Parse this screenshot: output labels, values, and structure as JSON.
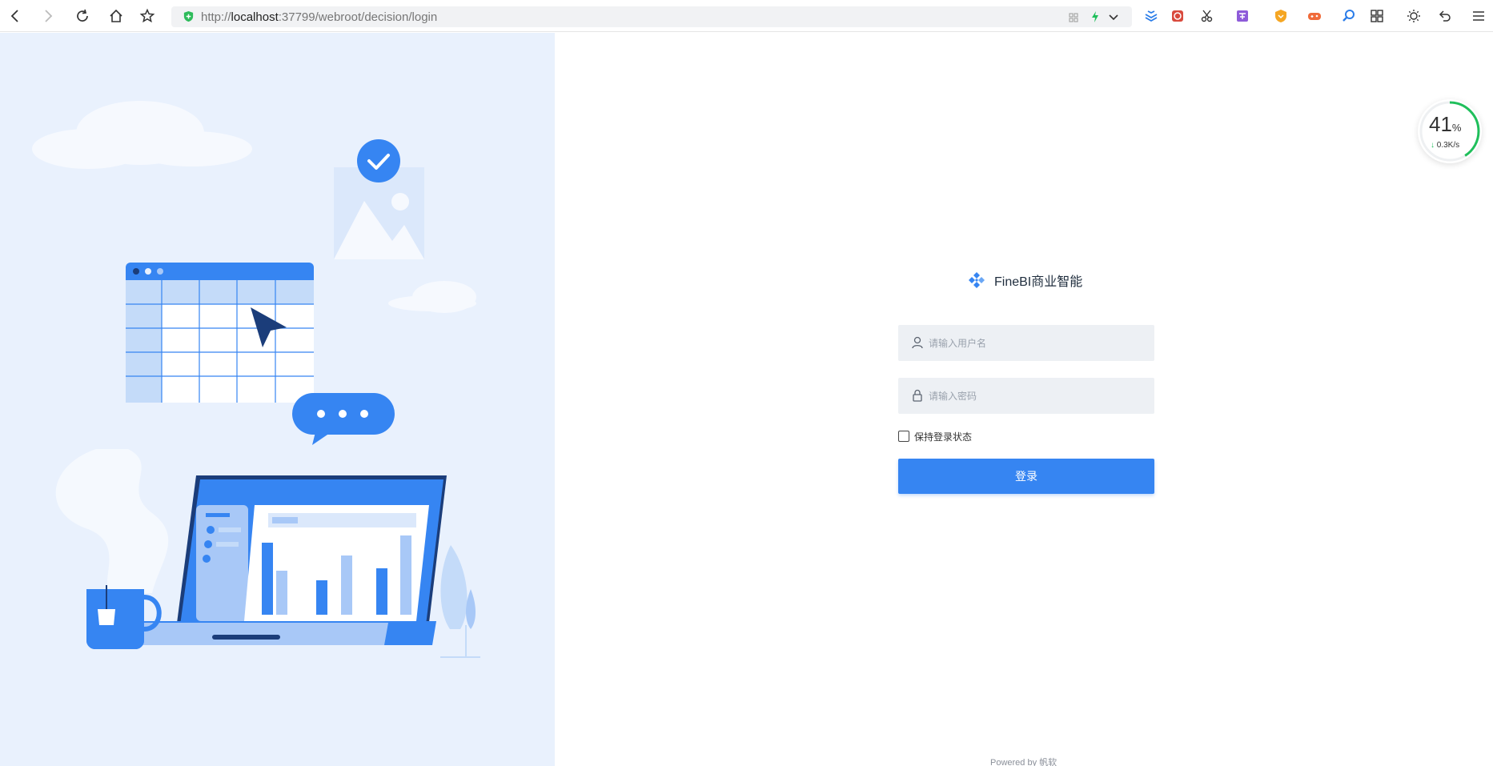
{
  "browser": {
    "url_scheme": "http://",
    "url_host": "localhost",
    "url_rest": ":37799/webroot/decision/login",
    "nav": {
      "back_icon": "back-arrow-icon",
      "forward_icon": "forward-arrow-icon",
      "reload_icon": "reload-icon",
      "home_icon": "home-icon",
      "bookmark_icon": "star-icon"
    }
  },
  "login": {
    "brand_name": "FineBI商业智能",
    "username_placeholder": "请输入用户名",
    "password_placeholder": "请输入密码",
    "remember_label": "保持登录状态",
    "remember_checked": false,
    "submit_label": "登录"
  },
  "footer": {
    "powered_by": "Powered by 帆软"
  },
  "speed_widget": {
    "percent": "41",
    "percent_unit": "%",
    "rate": "0.3K/s",
    "level": 0.41
  },
  "colors": {
    "accent": "#3685f2",
    "panel_bg": "#e9f1fd",
    "field_bg": "#edf0f4",
    "speed_green": "#1fbf5b"
  }
}
